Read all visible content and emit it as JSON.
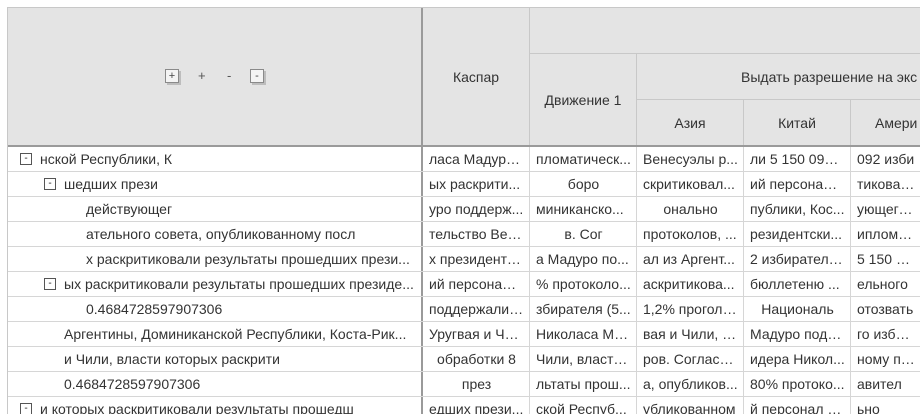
{
  "header": {
    "corner_controls": {
      "expand_all": "+",
      "plus": "+",
      "minus": "-",
      "collapse_all": "-"
    },
    "col_kaspar": "Каспар",
    "col_dvizhenie": "Движение 1",
    "col_group": "Выдать разрешение на экс",
    "col_asia": "Азия",
    "col_china": "Китай",
    "col_america": "Амери"
  },
  "rows": [
    {
      "toggle": "-",
      "label": "нской Республики, К",
      "c1": "ласа Мадуро...",
      "c2": "пломатическ...",
      "c3": "Венесуэлы р...",
      "c4": "ли 5 150 092 ...",
      "c5": "092 изби"
    },
    {
      "toggle": "-",
      "label": "шедших прези",
      "c1": "ых раскрити...",
      "c2": "боро",
      "c3": "скритиковал...",
      "c4": "ий персонал ...",
      "c5": "тиковали"
    },
    {
      "toggle": "",
      "label": "действующег",
      "c1": "уро поддерж...",
      "c2": "миниканско...",
      "c3": "онально",
      "c4": "публики, Кос...",
      "c5": "ующего ли"
    },
    {
      "toggle": "",
      "label": "ательного совета, опубликованному посл",
      "c1": "тельство Вен...",
      "c2": "в. Сог",
      "c3": "протоколов, ...",
      "c4": "резидентски...",
      "c5": "ипломати"
    },
    {
      "toggle": "",
      "label": "х раскритиковали результаты прошедших прези...",
      "c1": "х президентс...",
      "c2": "а Мадуро по...",
      "c3": "ал из Аргент...",
      "c4": "2 избирателя...",
      "c5": "5 150 092"
    },
    {
      "toggle": "-",
      "label": "ых раскритиковали результаты прошедших президе...",
      "c1": "ий персонал ...",
      "c2": "% протоколо...",
      "c3": "аскритикова...",
      "c4": "бюллетеню ...",
      "c5": "ельного"
    },
    {
      "toggle": "",
      "label": "0.4684728597907306",
      "c1": "поддержали ...",
      "c2": "збирателя (5...",
      "c3": "1,2% проголо...",
      "c4": "Националь",
      "c5": "отозвать"
    },
    {
      "toggle": "",
      "label": "Аргентины, Доминиканской Республики, Коста-Рик...",
      "c1": "Уругвая и Чи...",
      "c2": "Николаса Ма...",
      "c3": "вая и Чили, в...",
      "c4": "Мадуро подд...",
      "c5": "го избира"
    },
    {
      "toggle": "",
      "label": "и Чили, власти которых раскрити",
      "c1": "обработки 8",
      "c2": "Чили, власти...",
      "c3": "ров. Согласн...",
      "c4": "идера Никол...",
      "c5": "ному посл"
    },
    {
      "toggle": "",
      "label": "0.4684728597907306",
      "c1": "през",
      "c2": "льтаты прош...",
      "c3": "а, опубликов...",
      "c4": "80% протоко...",
      "c5": "авител"
    },
    {
      "toggle": "-",
      "label": "и которых раскритиковали результаты прошедш",
      "c1": "едших прези...",
      "c2": "ской Респуб...",
      "c3": "убликованном",
      "c4": "й персонал и...",
      "c5": "ьно"
    }
  ]
}
